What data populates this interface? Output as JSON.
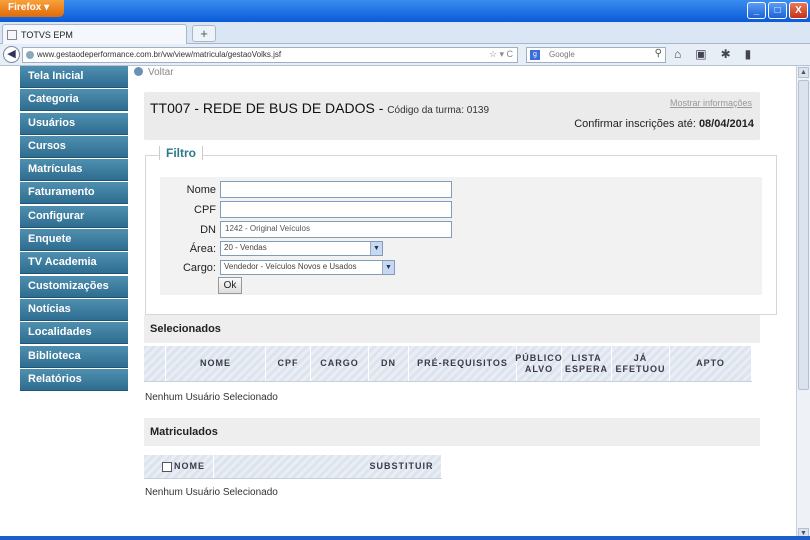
{
  "browser": {
    "menu_label": "Firefox ▾",
    "tab_title": "TOTVS EPM",
    "url": "www.gestaodeperformance.com.br/vw/view/matricula/gestaoVolks.jsf",
    "search_placeholder": "Google",
    "window_buttons": [
      "_",
      "□",
      "X"
    ]
  },
  "sidebar": {
    "items": [
      {
        "label": "Tela Inicial"
      },
      {
        "label": "Categoria"
      },
      {
        "label": "Usuários"
      },
      {
        "label": "Cursos"
      },
      {
        "label": "Matrículas"
      },
      {
        "label": "Faturamento"
      },
      {
        "label": "Configurar"
      },
      {
        "label": "Enquete"
      },
      {
        "label": "TV Academia"
      },
      {
        "label": "Customizações"
      },
      {
        "label": "Notícias"
      },
      {
        "label": "Localidades"
      },
      {
        "label": "Biblioteca"
      },
      {
        "label": "Relatórios"
      }
    ]
  },
  "voltar_label": "Voltar",
  "course": {
    "title": "TT007 - REDE DE BUS DE DADOS - ",
    "code_label": "Código da turma: 0139",
    "show_info": "Mostrar informações",
    "confirm_label": "Confirmar inscrições até: ",
    "confirm_date": "08/04/2014"
  },
  "filter": {
    "legend": "Filtro",
    "nome_label": "Nome",
    "nome_value": "",
    "cpf_label": "CPF",
    "cpf_value": "",
    "dn_label": "DN",
    "dn_value": "1242 - Original Veículos",
    "area_label": "Área:",
    "area_value": "20 - Vendas",
    "cargo_label": "Cargo:",
    "cargo_value": "Vendedor - Veículos Novos e Usados",
    "ok_label": "Ok"
  },
  "selecionados": {
    "heading": "Selecionados",
    "columns": [
      "NOME",
      "CPF",
      "CARGO",
      "DN",
      "PRÉ-REQUISITOS",
      "PÚBLICO ALVO",
      "LISTA ESPERA",
      "JÁ EFETUOU",
      "APTO"
    ],
    "empty_text": "Nenhum Usuário Selecionado"
  },
  "matriculados": {
    "heading": "Matriculados",
    "columns": [
      "NOME",
      "SUBSTITUIR"
    ],
    "empty_text": "Nenhum Usuário Selecionado"
  }
}
